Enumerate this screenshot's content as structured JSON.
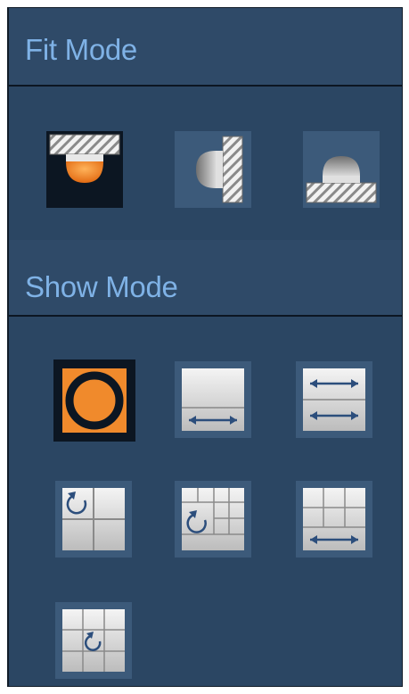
{
  "panel": {
    "fit_mode": {
      "title": "Fit Mode",
      "options": [
        {
          "icon": "ceiling-mount-icon",
          "selected": true
        },
        {
          "icon": "wall-mount-icon",
          "selected": false
        },
        {
          "icon": "ground-mount-icon",
          "selected": false
        }
      ]
    },
    "show_mode": {
      "title": "Show Mode",
      "options": [
        {
          "icon": "fisheye-original-icon",
          "selected": true
        },
        {
          "icon": "panorama-180-icon",
          "selected": false
        },
        {
          "icon": "dual-panorama-icon",
          "selected": false
        },
        {
          "icon": "fisheye-plus-3-icon",
          "selected": false
        },
        {
          "icon": "fisheye-plus-8-icon",
          "selected": false
        },
        {
          "icon": "panorama-plus-6-icon",
          "selected": false
        },
        {
          "icon": "fisheye-plus-8-grid-icon",
          "selected": false
        }
      ]
    }
  },
  "colors": {
    "panel_bg": "#2b4663",
    "header_text": "#7fb2e6",
    "selected_accent": "#f08a2c",
    "button_bg": "#3c5a7a",
    "icon_light": "#d8d8d8",
    "arrow_blue": "#2c4e7c"
  }
}
